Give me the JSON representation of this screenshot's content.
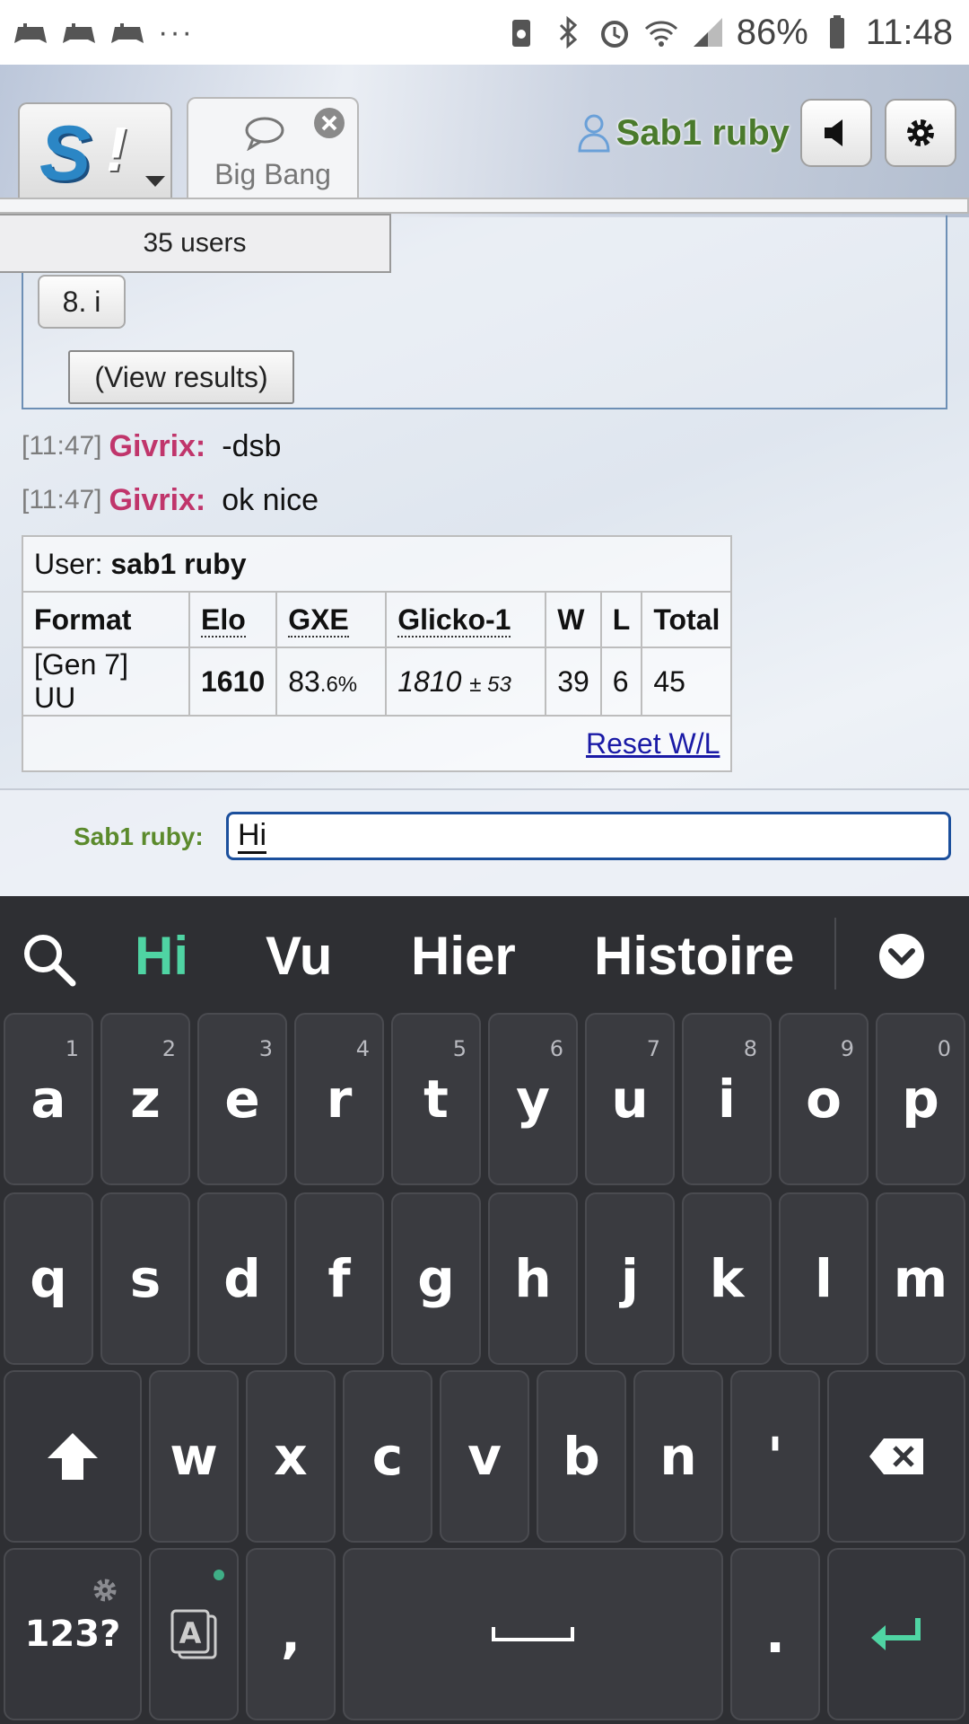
{
  "status_bar": {
    "battery_percent": "86%",
    "time": "11:48",
    "more": "···",
    "icons": [
      "gamepad-icon",
      "gamepad-icon",
      "gamepad-icon",
      "battery-saver-icon",
      "bluetooth-icon",
      "alarm-icon",
      "wifi-icon",
      "signal-icon",
      "battery-icon"
    ]
  },
  "header": {
    "room_tab": "Big Bang",
    "username": "Sab1 ruby"
  },
  "poll": {
    "users_count": "35 users",
    "option": "8. i",
    "view_results": "(View results)"
  },
  "chat": {
    "messages": [
      {
        "time": "[11:47]",
        "author": "Givrix:",
        "text": "-dsb"
      },
      {
        "time": "[11:47]",
        "author": "Givrix:",
        "text": "ok nice"
      }
    ]
  },
  "rank_table": {
    "user_label": "User:",
    "user_name": "sab1 ruby",
    "headers": [
      "Format",
      "Elo",
      "GXE",
      "Glicko-1",
      "W",
      "L",
      "Total"
    ],
    "row": {
      "format": "[Gen 7] UU",
      "elo": "1610",
      "gxe_main": "83",
      "gxe_decimal": ".6%",
      "glicko_main": "1810",
      "glicko_dev": "± 53",
      "w": "39",
      "l": "6",
      "total": "45"
    },
    "reset_link": "Reset W/L"
  },
  "input": {
    "label": "Sab1 ruby:",
    "value": "Hi"
  },
  "keyboard": {
    "suggestions": [
      "Hi",
      "Vu",
      "Hier",
      "Histoire"
    ],
    "row1": [
      {
        "key": "a",
        "num": "1"
      },
      {
        "key": "z",
        "num": "2"
      },
      {
        "key": "e",
        "num": "3"
      },
      {
        "key": "r",
        "num": "4"
      },
      {
        "key": "t",
        "num": "5"
      },
      {
        "key": "y",
        "num": "6"
      },
      {
        "key": "u",
        "num": "7"
      },
      {
        "key": "i",
        "num": "8"
      },
      {
        "key": "o",
        "num": "9"
      },
      {
        "key": "p",
        "num": "0"
      }
    ],
    "row2": [
      "q",
      "s",
      "d",
      "f",
      "g",
      "h",
      "j",
      "k",
      "l",
      "m"
    ],
    "row3": [
      "w",
      "x",
      "c",
      "v",
      "b",
      "n",
      "'"
    ],
    "symbols_key": "123?",
    "comma_key": ",",
    "period_key": ".",
    "accent_color": "#4fd4a3"
  },
  "colors": {
    "author": "#c0356b",
    "username": "#4a7a2c",
    "link": "#1a1aa6",
    "input_border": "#1b4f9c"
  }
}
